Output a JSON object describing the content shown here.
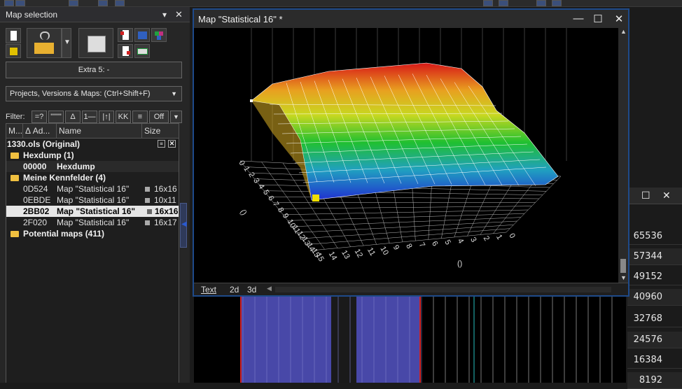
{
  "left_panel": {
    "title": "Map selection",
    "extra_button": "Extra 5:  -",
    "projects_dropdown": "Projects, Versions & Maps:  (Ctrl+Shift+F)",
    "filter_label": "Filter:",
    "filter_buttons": [
      "=?",
      "\"\"\"\"",
      "Δ",
      "1—",
      "|↑|",
      "KK",
      "≡",
      "Off"
    ],
    "columns": [
      "M...",
      "Δ Ad...",
      "Name",
      "Size"
    ],
    "project_name": "1330.ols (Original)",
    "folders": [
      {
        "label": "Hexdump (1)"
      },
      {
        "label": "Meine Kennfelder (4)"
      },
      {
        "label": "Potential maps (411)"
      }
    ],
    "hexdump_entry": {
      "addr": "00000",
      "name": "Hexdump"
    },
    "maps": [
      {
        "addr": "0D524",
        "name": "Map \"Statistical 16\"",
        "size": "16x16"
      },
      {
        "addr": "0EBDE",
        "name": "Map \"Statistical 16\"",
        "size": "10x11"
      },
      {
        "addr": "2BB02",
        "name": "Map \"Statistical 16\"",
        "size": "16x16"
      },
      {
        "addr": "2F020",
        "name": "Map \"Statistical 16\"",
        "size": "16x17"
      }
    ]
  },
  "map_window": {
    "title": "Map \"Statistical 16\" *",
    "tabs": [
      "Text",
      "2d",
      "3d"
    ],
    "axis_placeholder_x": "()",
    "axis_placeholder_y": "()",
    "front_axis_ticks": [
      "15",
      "14",
      "13",
      "12",
      "11",
      "10",
      "9",
      "8",
      "7",
      "6",
      "5",
      "4",
      "3",
      "2",
      "1",
      "0"
    ],
    "side_axis_ticks": [
      "0",
      "1",
      "2",
      "3",
      "4",
      "5",
      "6",
      "7",
      "8",
      "9",
      "10",
      "11",
      "12",
      "13",
      "14",
      "15"
    ]
  },
  "right_panel": {
    "values": [
      "65536",
      "57344",
      "49152",
      "40960",
      "32768",
      "24576",
      "16384",
      "8192"
    ]
  },
  "colors": {
    "accent": "#1e4a8a",
    "grid": "#bbbbbb",
    "hex_highlight": "#4848a8",
    "hex_border": "#d02020"
  }
}
